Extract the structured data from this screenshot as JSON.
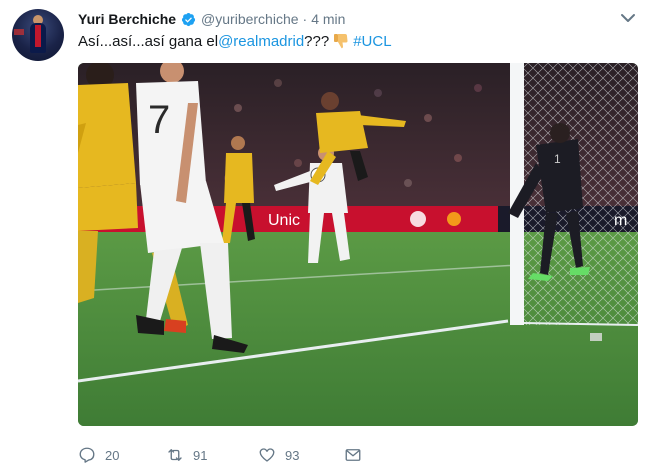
{
  "tweet": {
    "author_name": "Yuri Berchiche",
    "author_handle": "@yuriberchiche",
    "separator": "·",
    "time": "4 min",
    "text_prefix": "Así...así...así gana el ",
    "mention": "@realmadrid",
    "text_suffix": "???",
    "hashtag": "#UCL"
  },
  "media": {
    "board_text": "Unic",
    "board_text_right": "m",
    "shirt_number": "7",
    "keeper_number": "1"
  },
  "actions": {
    "reply_count": "20",
    "retweet_count": "91",
    "like_count": "93"
  },
  "colors": {
    "link": "#1b95e0",
    "verified": "#1da1f2",
    "muted": "#657786",
    "pitch": "#3e7d3a"
  },
  "icons": {
    "verified": "verified-badge-icon",
    "chevron": "chevron-down-icon",
    "emoji": "thumbs-down-emoji",
    "reply": "reply-icon",
    "retweet": "retweet-icon",
    "like": "heart-icon",
    "dm": "envelope-icon"
  }
}
